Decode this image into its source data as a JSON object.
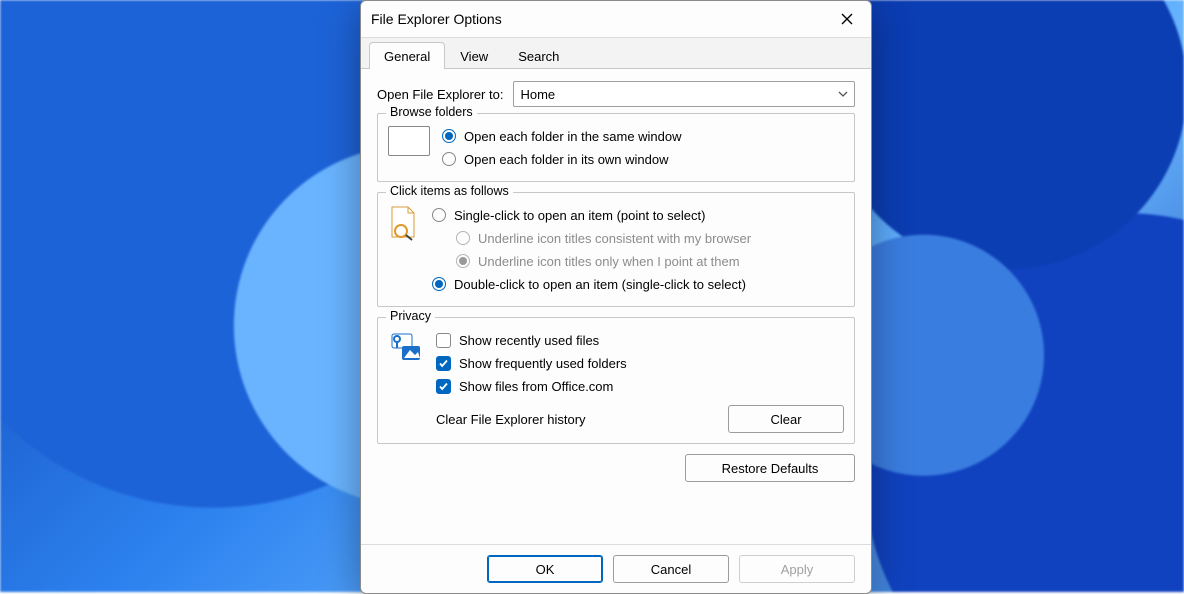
{
  "window": {
    "title": "File Explorer Options"
  },
  "tabs": {
    "general": "General",
    "view": "View",
    "search": "Search"
  },
  "open_to": {
    "label": "Open File Explorer to:",
    "value": "Home"
  },
  "browse": {
    "legend": "Browse folders",
    "same": "Open each folder in the same window",
    "own": "Open each folder in its own window"
  },
  "click": {
    "legend": "Click items as follows",
    "single": "Single-click to open an item (point to select)",
    "ul_browser": "Underline icon titles consistent with my browser",
    "ul_point": "Underline icon titles only when I point at them",
    "double": "Double-click to open an item (single-click to select)"
  },
  "privacy": {
    "legend": "Privacy",
    "recent": "Show recently used files",
    "frequent": "Show frequently used folders",
    "office": "Show files from Office.com",
    "clear_label": "Clear File Explorer history",
    "clear_btn": "Clear"
  },
  "buttons": {
    "restore": "Restore Defaults",
    "ok": "OK",
    "cancel": "Cancel",
    "apply": "Apply"
  }
}
